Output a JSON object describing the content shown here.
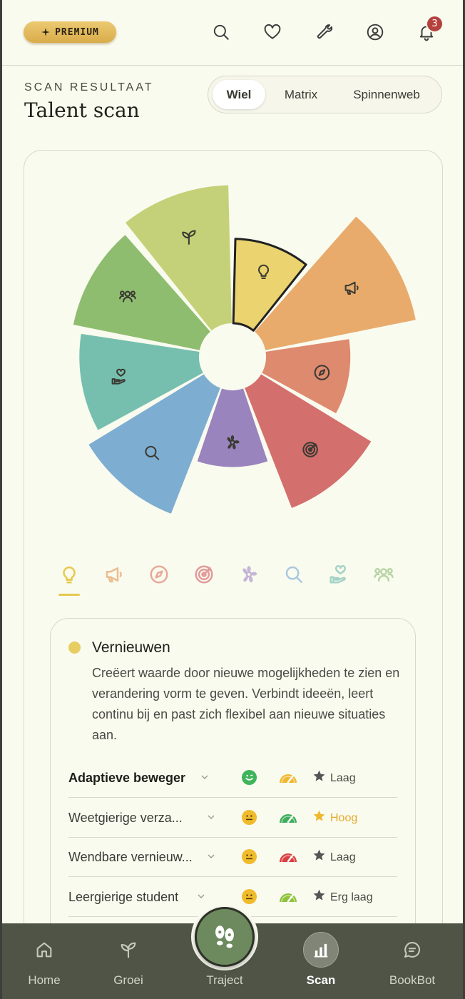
{
  "header": {
    "premium_label": "PREMIUM",
    "notifications_count": "3",
    "icons": [
      "search-icon",
      "heart-icon",
      "wrench-icon",
      "user-icon",
      "bell-icon"
    ]
  },
  "page": {
    "eyebrow": "SCAN RESULTAAT",
    "title": "Talent scan"
  },
  "view_switch": {
    "options": [
      "Wiel",
      "Matrix",
      "Spinnenweb"
    ],
    "selected": "Wiel"
  },
  "chart_data": {
    "type": "polar-area",
    "segments": [
      {
        "icon": "lightbulb-icon",
        "color": "#ebd46f",
        "value": 0.55,
        "selected": true
      },
      {
        "icon": "megaphone-icon",
        "color": "#e8ab6c",
        "value": 1.0
      },
      {
        "icon": "compass-icon",
        "color": "#de8a6f",
        "value": 0.55
      },
      {
        "icon": "target-icon",
        "color": "#d36f6c",
        "value": 0.84
      },
      {
        "icon": "flower-icon",
        "color": "#9a84bd",
        "value": 0.5
      },
      {
        "icon": "magnifier-icon",
        "color": "#7eadd2",
        "value": 0.88
      },
      {
        "icon": "hand-heart-icon",
        "color": "#76bfae",
        "value": 0.78
      },
      {
        "icon": "people-icon",
        "color": "#8fbd70",
        "value": 0.84
      },
      {
        "icon": "sprout-icon",
        "color": "#c5d178",
        "value": 0.9
      }
    ]
  },
  "category_tabs": [
    {
      "icon": "lightbulb-icon",
      "color": "#e6c94d"
    },
    {
      "icon": "megaphone-icon",
      "color": "#ecbd8e"
    },
    {
      "icon": "compass-icon",
      "color": "#e8a898"
    },
    {
      "icon": "target-icon",
      "color": "#e19b9a"
    },
    {
      "icon": "flower-icon",
      "color": "#c3b6d6"
    },
    {
      "icon": "magnifier-icon",
      "color": "#a9c9e0"
    },
    {
      "icon": "hand-heart-icon",
      "color": "#a4d3c6"
    },
    {
      "icon": "people-icon",
      "color": "#b9d5a5"
    }
  ],
  "detail": {
    "name": "Vernieuwen",
    "description": "Creëert waarde door nieuwe mogelijkheden te zien en verandering vorm te geven. Verbindt ideeën, leert continu bij en past zich flexibel aan nieuwe situaties aan.",
    "rows": [
      {
        "label": "Adaptieve beweger",
        "bold": true,
        "face": "smile",
        "face_color": "#3fb55a",
        "gauge_color": "#f0b830",
        "star_color": "#555555",
        "level": "Laag",
        "level_color": "#4a4a44"
      },
      {
        "label": "Weetgierige verza...",
        "bold": false,
        "face": "neutral",
        "face_color": "#f0bb2c",
        "gauge_color": "#3fae5c",
        "star_color": "#f0b830",
        "level": "Hoog",
        "level_color": "#e3a92a"
      },
      {
        "label": "Wendbare vernieuw...",
        "bold": false,
        "face": "neutral",
        "face_color": "#f0bb2c",
        "gauge_color": "#d94040",
        "star_color": "#555555",
        "level": "Laag",
        "level_color": "#4a4a44"
      },
      {
        "label": "Leergierige student",
        "bold": false,
        "face": "neutral",
        "face_color": "#f0bb2c",
        "gauge_color": "#8fc23a",
        "star_color": "#555555",
        "level": "Erg laag",
        "level_color": "#4a4a44"
      }
    ]
  },
  "nav": {
    "items": [
      {
        "label": "Home",
        "icon": "home-icon"
      },
      {
        "label": "Groei",
        "icon": "sprout-icon"
      },
      {
        "label": "Traject",
        "icon": "footsteps-icon"
      },
      {
        "label": "Scan",
        "icon": "bar-chart-icon"
      },
      {
        "label": "BookBot",
        "icon": "chat-icon"
      }
    ],
    "active": "Scan"
  }
}
